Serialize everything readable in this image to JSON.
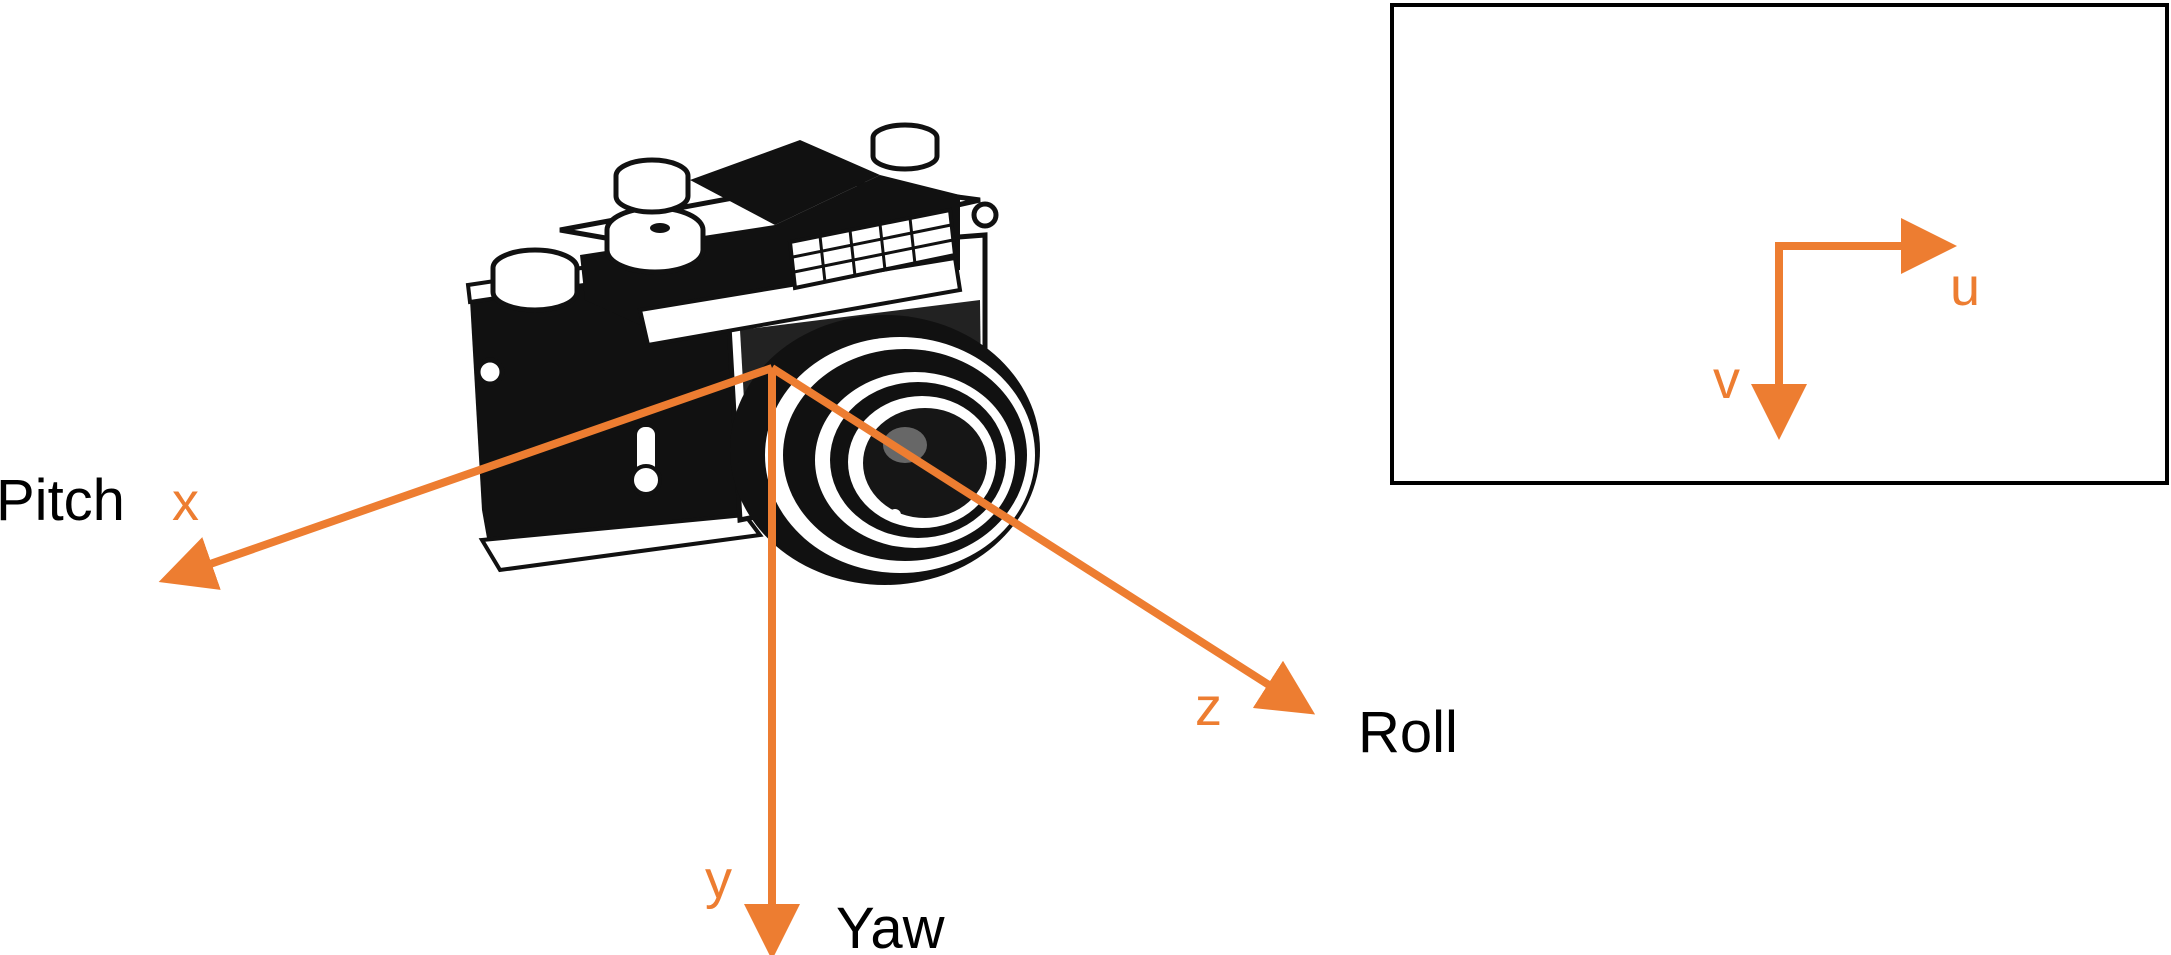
{
  "colors": {
    "axis": "#ED7D31",
    "label": "#000000",
    "frame": "#000000",
    "camera": "#111111"
  },
  "icons": {
    "camera": "camera-icon"
  },
  "camera_axes": {
    "x": {
      "axis_label": "x",
      "rotation_label": "Pitch"
    },
    "y": {
      "axis_label": "y",
      "rotation_label": "Yaw"
    },
    "z": {
      "axis_label": "z",
      "rotation_label": "Roll"
    }
  },
  "image_plane": {
    "u_label": "u",
    "v_label": "v"
  }
}
